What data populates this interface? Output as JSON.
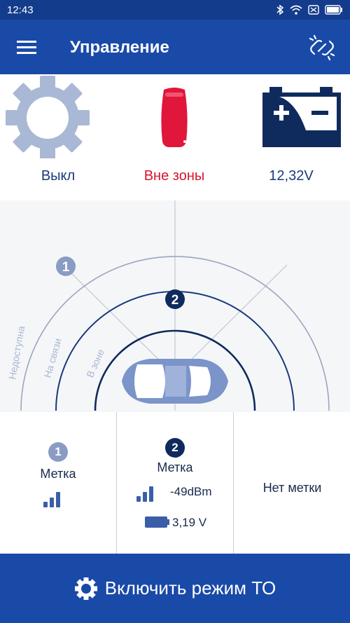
{
  "statusbar": {
    "time": "12:43",
    "icons": [
      "bluetooth-icon",
      "wifi-icon",
      "sim-off-icon",
      "battery-icon"
    ]
  },
  "appbar": {
    "title": "Управление",
    "menu_icon": "hamburger-icon",
    "action_icon": "link-broken-icon"
  },
  "status": {
    "engine": {
      "icon": "gear-icon",
      "label": "Выкл"
    },
    "keyfob": {
      "icon": "keyfob-icon",
      "label": "Вне зоны"
    },
    "battery": {
      "icon": "car-battery-icon",
      "label": "12,32V"
    }
  },
  "radar": {
    "zones": [
      "Недоступна",
      "На связи",
      "В зоне"
    ],
    "tag1": "1",
    "tag2": "2"
  },
  "tags": {
    "tag1": {
      "badge": "1",
      "label": "Метка",
      "signal_bars": 3
    },
    "tag2": {
      "badge": "2",
      "label": "Метка",
      "signal": "-49dBm",
      "battery": "3,19 V",
      "signal_bars": 3
    },
    "tag3": {
      "label": "Нет метки"
    }
  },
  "bottom_button": {
    "label": "Включить режим ТО",
    "icon": "gear-icon"
  },
  "colors": {
    "primary": "#1a4aa8",
    "dark_navy": "#0f2a5c",
    "alert_red": "#d8152c",
    "gear_gray": "#a9b8d4"
  }
}
